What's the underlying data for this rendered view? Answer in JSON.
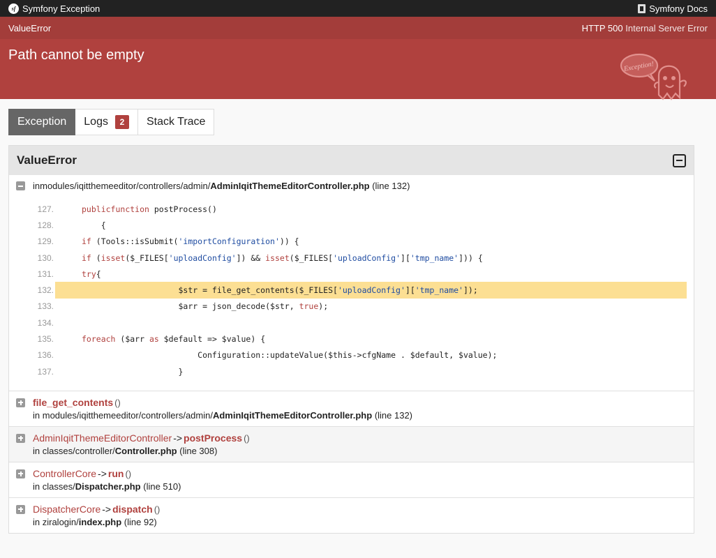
{
  "topbar": {
    "brand": "Symfony Exception",
    "docs_label": "Symfony Docs"
  },
  "header": {
    "class": "ValueError",
    "status_code": "HTTP 500",
    "status_text": "Internal Server Error",
    "message": "Path cannot be empty",
    "mascot_text": "Exception!"
  },
  "tabs": {
    "exception": "Exception",
    "logs": "Logs",
    "logs_count": "2",
    "stack_trace": "Stack Trace"
  },
  "trace": {
    "title": "ValueError",
    "first": {
      "in": "in ",
      "path": "modules/iqitthemeeditor/controllers/admin/",
      "file": "AdminIqitThemeEditorController.php",
      "line": "(line 132)"
    },
    "code": [
      {
        "n": "127.",
        "t": "    public function postProcess()"
      },
      {
        "n": "128.",
        "t": "    {"
      },
      {
        "n": "129.",
        "t": "        if (Tools::isSubmit('importConfiguration')) {"
      },
      {
        "n": "130.",
        "t": "            if (isset($_FILES['uploadConfig']) && isset($_FILES['uploadConfig']['tmp_name'])) {"
      },
      {
        "n": "131.",
        "t": "                try{"
      },
      {
        "n": "132.",
        "t": "                    $str = file_get_contents($_FILES['uploadConfig']['tmp_name']);"
      },
      {
        "n": "133.",
        "t": "                    $arr = json_decode($str, true);"
      },
      {
        "n": "134.",
        "t": ""
      },
      {
        "n": "135.",
        "t": "                    foreach ($arr as $default => $value) {"
      },
      {
        "n": "136.",
        "t": "                        Configuration::updateValue($this->cfgName . $default, $value);"
      },
      {
        "n": "137.",
        "t": "                    }"
      }
    ],
    "frames": [
      {
        "class": "",
        "fn": "file_get_contents",
        "args": "()",
        "in": "in ",
        "path": "modules/iqitthemeeditor/controllers/admin/",
        "file": "AdminIqitThemeEditorController.php",
        "line": "(line 132)"
      },
      {
        "class": "AdminIqitThemeEditorController",
        "fn": "postProcess",
        "args": "()",
        "in": "in ",
        "path": "classes/controller/",
        "file": "Controller.php",
        "line": "(line 308)"
      },
      {
        "class": "ControllerCore",
        "fn": "run",
        "args": "()",
        "in": "in ",
        "path": "classes/",
        "file": "Dispatcher.php",
        "line": "(line 510)"
      },
      {
        "class": "DispatcherCore",
        "fn": "dispatch",
        "args": "()",
        "in": "in ",
        "path": "ziralogin/",
        "file": "index.php",
        "line": "(line 92)"
      }
    ],
    "arrow": "->"
  }
}
